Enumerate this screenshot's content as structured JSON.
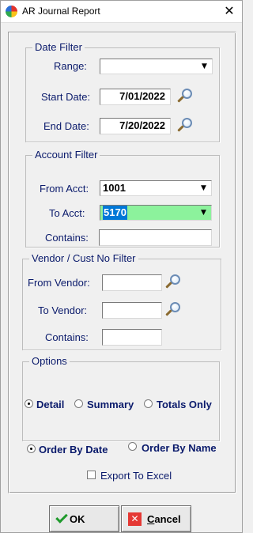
{
  "window": {
    "title": "AR Journal Report",
    "close_glyph": "✕"
  },
  "date_filter": {
    "title": "Date Filter",
    "range_label": "Range:",
    "range_value": "",
    "start_label": "Start Date:",
    "start_value": "7/01/2022",
    "end_label": "End Date:",
    "end_value": "7/20/2022"
  },
  "account_filter": {
    "title": "Account Filter",
    "from_label": "From Acct:",
    "from_value": "1001",
    "to_label": "To Acct:",
    "to_value": "5170",
    "contains_label": "Contains:",
    "contains_value": ""
  },
  "vendor_filter": {
    "title": "Vendor / Cust No Filter",
    "from_label": "From Vendor:",
    "from_value": "",
    "to_label": "To Vendor:",
    "to_value": "",
    "contains_label": "Contains:",
    "contains_value": ""
  },
  "options": {
    "title": "Options",
    "report_types": [
      "Detail",
      "Summary",
      "Totals Only"
    ],
    "selected_report_type": "Detail",
    "order_options": [
      "Order By Date",
      "Order By Name"
    ],
    "selected_order": "Order By Date",
    "export_label": "Export To Excel",
    "export_checked": false
  },
  "buttons": {
    "ok_label": "OK",
    "cancel_label": "Cancel"
  },
  "icons": {
    "app": "app-logo-icon",
    "lookup": "magnifier-icon",
    "dropdown": "chevron-down-icon",
    "ok": "checkmark-icon",
    "cancel": "x-icon"
  },
  "colors": {
    "label_text": "#0a1a6b",
    "to_acct_highlight": "#8cf29c",
    "selection": "#0078d7"
  }
}
